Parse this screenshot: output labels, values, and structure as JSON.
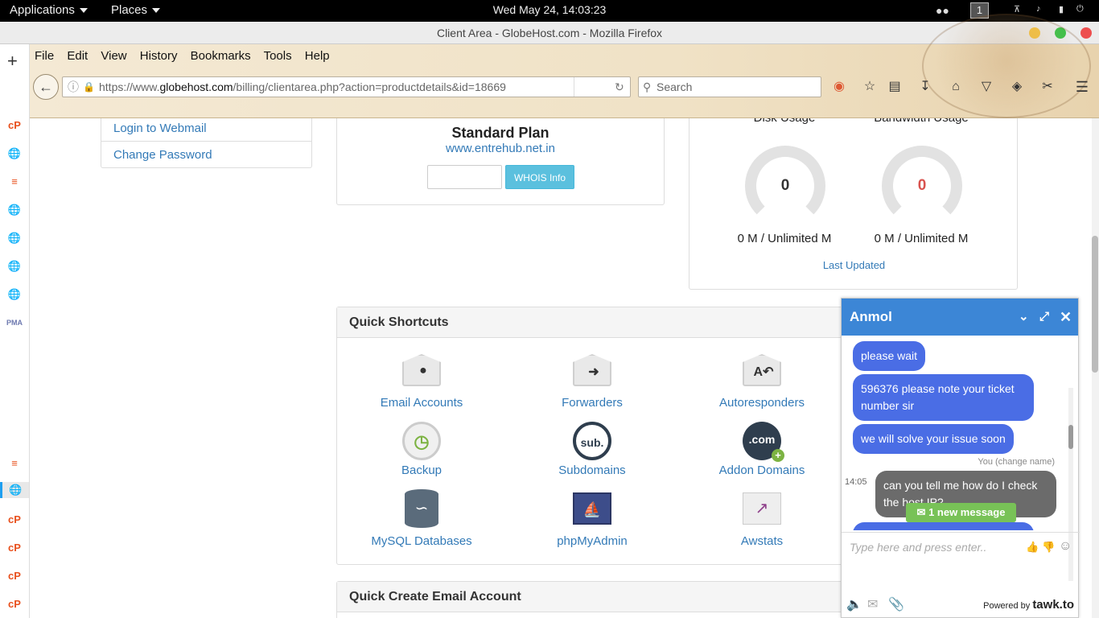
{
  "topbar": {
    "applications": "Applications",
    "places": "Places",
    "clock": "Wed May 24, 14:03:23",
    "workspace": "1"
  },
  "window": {
    "title": "Client Area - GlobeHost.com - Mozilla Firefox"
  },
  "menubar": [
    "File",
    "Edit",
    "View",
    "History",
    "Bookmarks",
    "Tools",
    "Help"
  ],
  "urlbar": {
    "prefix": "https://www.",
    "domain": "globehost.com",
    "path": "/billing/clientarea.php?action=productdetails&id=18669"
  },
  "search": {
    "placeholder": "Search"
  },
  "left_links": {
    "webmail": "Login to Webmail",
    "password": "Change Password"
  },
  "plan": {
    "name": "Standard Plan",
    "domain": "www.entrehub.net.in",
    "whois_button": "WHOIS Info"
  },
  "usage": {
    "disk_title": "Disk Usage",
    "disk_value": "0",
    "disk_detail": "0 M / Unlimited M",
    "bandwidth_title": "Bandwidth Usage",
    "bandwidth_value": "0",
    "bandwidth_detail": "0 M / Unlimited M",
    "last_updated": "Last Updated",
    "bandwidth_color": "#d9534f"
  },
  "shortcuts": {
    "title": "Quick Shortcuts",
    "items": [
      {
        "label": "Email Accounts",
        "icon": "email-accounts-icon"
      },
      {
        "label": "Forwarders",
        "icon": "forwarders-icon"
      },
      {
        "label": "Autoresponders",
        "icon": "autoresponders-icon"
      },
      {
        "label": "Backup",
        "icon": "backup-icon"
      },
      {
        "label": "Subdomains",
        "icon": "subdomains-icon"
      },
      {
        "label": "Addon Domains",
        "icon": "addon-domains-icon"
      },
      {
        "label": "MySQL Databases",
        "icon": "mysql-icon"
      },
      {
        "label": "phpMyAdmin",
        "icon": "phpmyadmin-icon"
      },
      {
        "label": "Awstats",
        "icon": "awstats-icon"
      }
    ],
    "sub_glyph": "sub.",
    "com_glyph": ".com"
  },
  "quick_create": {
    "title": "Quick Create Email Account"
  },
  "chat": {
    "agent": "Anmol",
    "messages": [
      "please wait",
      "596376 please note your ticket number sir",
      "we will solve your issue soon"
    ],
    "you_label": "You (change name)",
    "my_time": "14:05",
    "my_message": "can you tell me how do I check the host IP?",
    "new_message": "1 new message",
    "input_placeholder": "Type here and press enter..",
    "powered_by": "Powered by",
    "brand": "tawk.to",
    "header_color": "#3c86d6"
  }
}
